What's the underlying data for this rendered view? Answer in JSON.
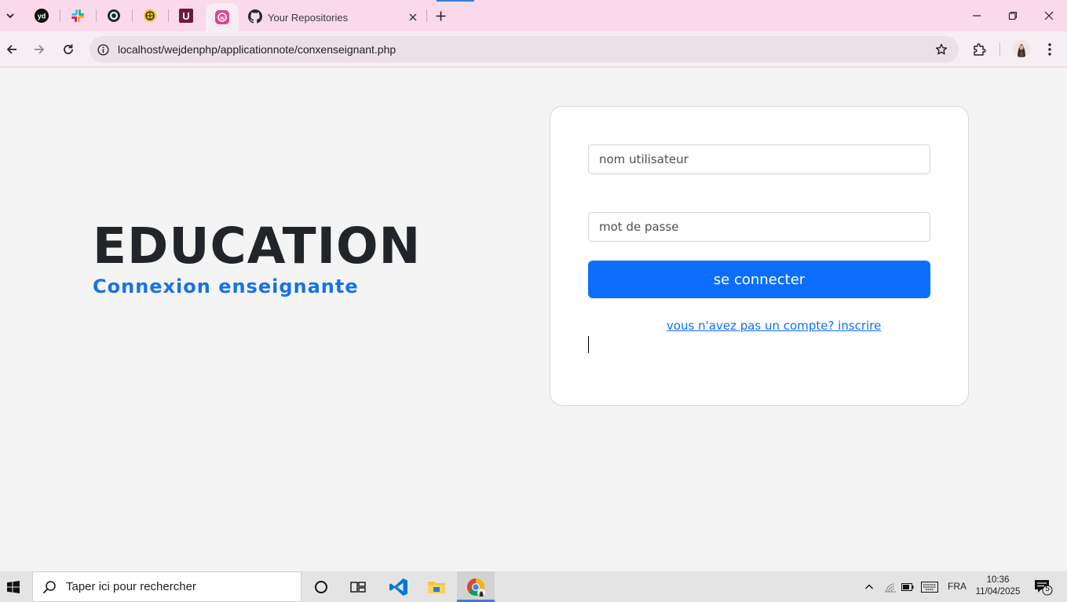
{
  "browser": {
    "active_tab_title": "Your Repositories",
    "url": "localhost/wejdenphp/applicationnote/conxenseignant.php",
    "pinned_tabs": [
      "yd-icon",
      "slack-icon",
      "circle-app-icon",
      "yellow-app-icon",
      "u-app-icon",
      "pink-app-icon"
    ]
  },
  "page": {
    "brand": "EDUCATION",
    "subtitle": "Connexion enseignante",
    "form": {
      "username_placeholder": "nom utilisateur",
      "password_placeholder": "mot de passe",
      "submit_label": "se connecter",
      "signup_link": "vous n'avez pas un compte? inscrire"
    }
  },
  "taskbar": {
    "search_placeholder": "Taper ici pour rechercher",
    "language": "FRA",
    "time": "10:36",
    "date": "11/04/2025",
    "notification_count": "5"
  },
  "colors": {
    "accent": "#0d6efd",
    "subtitle": "#1772e6",
    "tabstrip": "#f9d9ea"
  }
}
